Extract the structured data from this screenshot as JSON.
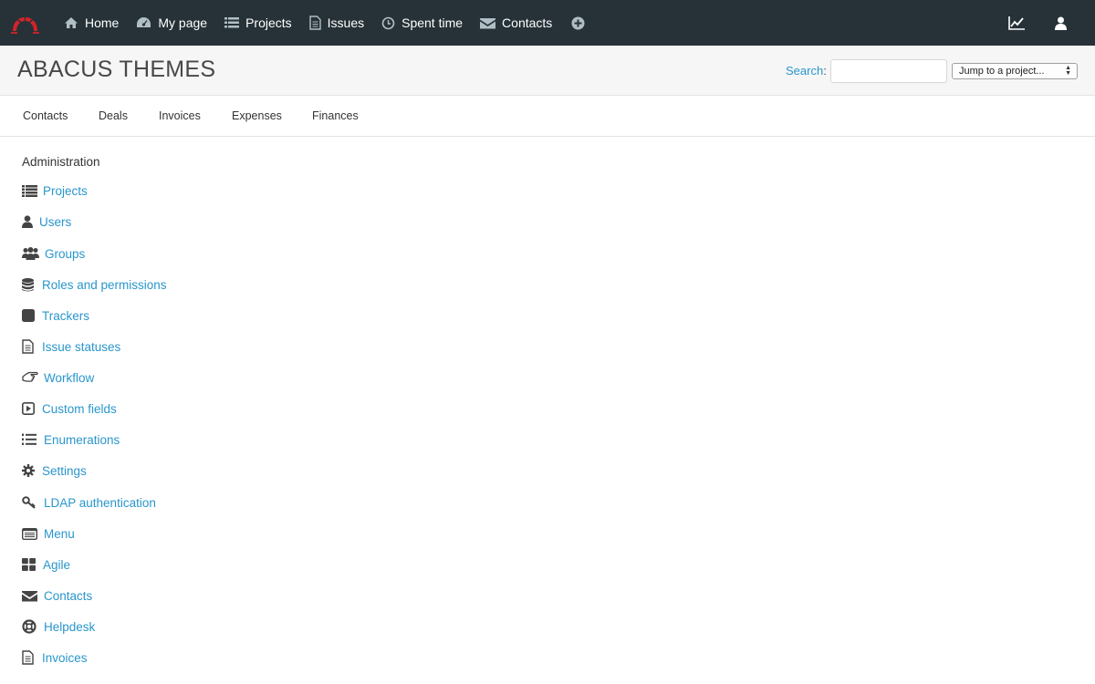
{
  "topnav": {
    "items": [
      {
        "label": "Home",
        "icon": "home-icon"
      },
      {
        "label": "My page",
        "icon": "dashboard-icon"
      },
      {
        "label": "Projects",
        "icon": "list-icon"
      },
      {
        "label": "Issues",
        "icon": "document-icon"
      },
      {
        "label": "Spent time",
        "icon": "clock-icon"
      },
      {
        "label": "Contacts",
        "icon": "envelope-icon"
      }
    ]
  },
  "header": {
    "project_title": "ABACUS THEMES",
    "search_label": "Search",
    "search_colon": ":",
    "search_value": "",
    "jump_label": "Jump to a project..."
  },
  "tabs": [
    {
      "label": "Contacts"
    },
    {
      "label": "Deals"
    },
    {
      "label": "Invoices"
    },
    {
      "label": "Expenses"
    },
    {
      "label": "Finances"
    }
  ],
  "admin": {
    "title": "Administration",
    "items": [
      {
        "label": "Projects",
        "icon": "list-icon"
      },
      {
        "label": "Users",
        "icon": "user-icon"
      },
      {
        "label": "Groups",
        "icon": "group-icon"
      },
      {
        "label": "Roles and permissions",
        "icon": "database-icon"
      },
      {
        "label": "Trackers",
        "icon": "square-icon"
      },
      {
        "label": "Issue statuses",
        "icon": "document-icon"
      },
      {
        "label": "Workflow",
        "icon": "hand-pointer-icon"
      },
      {
        "label": "Custom fields",
        "icon": "play-square-icon"
      },
      {
        "label": "Enumerations",
        "icon": "ordered-list-icon"
      },
      {
        "label": "Settings",
        "icon": "gear-icon"
      },
      {
        "label": "LDAP authentication",
        "icon": "key-icon"
      },
      {
        "label": "Menu",
        "icon": "menu-window-icon"
      },
      {
        "label": "Agile",
        "icon": "grid-icon"
      },
      {
        "label": "Contacts",
        "icon": "envelope-icon"
      },
      {
        "label": "Helpdesk",
        "icon": "lifebuoy-icon"
      },
      {
        "label": "Invoices",
        "icon": "document-icon"
      }
    ]
  },
  "colors": {
    "topbar": "#263238",
    "link": "#2996cc",
    "header_bg": "#f6f6f6",
    "logo_red": "#d2232a"
  }
}
